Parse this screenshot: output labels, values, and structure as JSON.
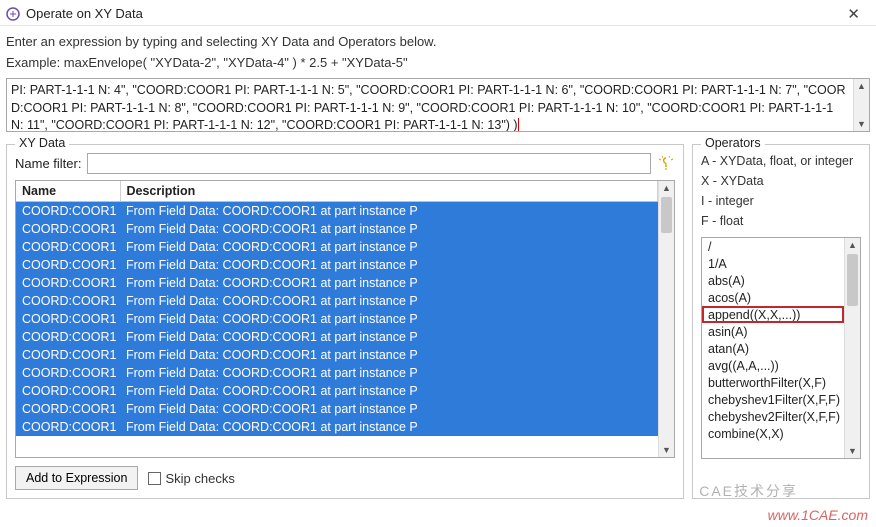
{
  "window": {
    "title": "Operate on XY Data",
    "close": "✕"
  },
  "intro": "Enter an expression by typing and selecting XY Data and Operators below.",
  "example": "Example: maxEnvelope( \"XYData-2\", \"XYData-4\" ) * 2.5 + \"XYData-5\"",
  "expression": {
    "text": "PI: PART-1-1-1 N: 4\", \"COORD:COOR1 PI: PART-1-1-1 N: 5\", \"COORD:COOR1 PI: PART-1-1-1 N: 6\", \"COORD:COOR1 PI: PART-1-1-1 N: 7\", \"COORD:COOR1 PI: PART-1-1-1 N: 8\", \"COORD:COOR1 PI: PART-1-1-1 N: 9\", \"COORD:COOR1 PI: PART-1-1-1 N: 10\", \"COORD:COOR1 PI: PART-1-1-1 N: 11\", \"COORD:COOR1 PI: PART-1-1-1 N: 12\", \"COORD:COOR1 PI: PART-1-1-1 N: 13\") )"
  },
  "xydata": {
    "legend": "XY Data",
    "filter_label": "Name filter:",
    "filter_value": "",
    "columns": {
      "name": "Name",
      "description": "Description"
    },
    "rows": [
      {
        "name": "COORD:COOR1",
        "desc": "From Field Data: COORD:COOR1  at part instance P"
      },
      {
        "name": "COORD:COOR1",
        "desc": "From Field Data: COORD:COOR1  at part instance P"
      },
      {
        "name": "COORD:COOR1",
        "desc": "From Field Data: COORD:COOR1  at part instance P"
      },
      {
        "name": "COORD:COOR1",
        "desc": "From Field Data: COORD:COOR1  at part instance P"
      },
      {
        "name": "COORD:COOR1",
        "desc": "From Field Data: COORD:COOR1  at part instance P"
      },
      {
        "name": "COORD:COOR1",
        "desc": "From Field Data: COORD:COOR1  at part instance P"
      },
      {
        "name": "COORD:COOR1",
        "desc": "From Field Data: COORD:COOR1  at part instance P"
      },
      {
        "name": "COORD:COOR1",
        "desc": "From Field Data: COORD:COOR1  at part instance P"
      },
      {
        "name": "COORD:COOR1",
        "desc": "From Field Data: COORD:COOR1  at part instance P"
      },
      {
        "name": "COORD:COOR1",
        "desc": "From Field Data: COORD:COOR1  at part instance P"
      },
      {
        "name": "COORD:COOR1",
        "desc": "From Field Data: COORD:COOR1  at part instance P"
      },
      {
        "name": "COORD:COOR1",
        "desc": "From Field Data: COORD:COOR1  at part instance P"
      },
      {
        "name": "COORD:COOR1",
        "desc": "From Field Data: COORD:COOR1  at part instance P"
      }
    ],
    "add_button": "Add to Expression",
    "skip_checks": "Skip checks"
  },
  "operators": {
    "legend": "Operators",
    "legend_lines": [
      "A - XYData, float, or integer",
      "X - XYData",
      "I - integer",
      "F - float"
    ],
    "items": [
      "/",
      "1/A",
      "abs(A)",
      "acos(A)",
      "append((X,X,...))",
      "asin(A)",
      "atan(A)",
      "avg((A,A,...))",
      "butterworthFilter(X,F)",
      "chebyshev1Filter(X,F,F)",
      "chebyshev2Filter(X,F,F)",
      "combine(X,X)"
    ],
    "highlight_index": 4
  },
  "watermark": {
    "a": "www.1CAE.com",
    "b": "CAE技术分享"
  }
}
